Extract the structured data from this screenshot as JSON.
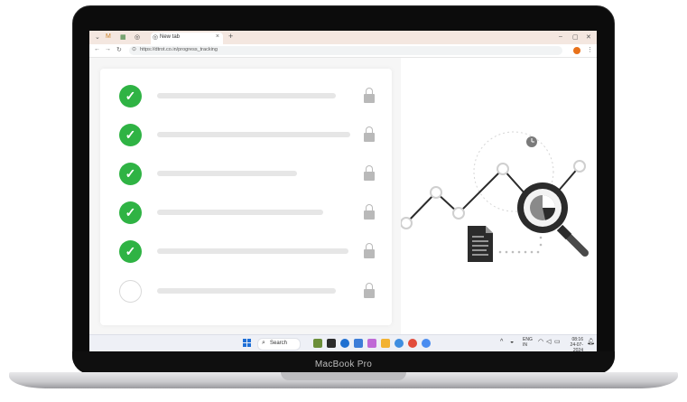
{
  "device": {
    "brand": "MacBook Pro"
  },
  "browser": {
    "tab": {
      "title": "New tab"
    },
    "address_bar": {
      "url": "https://dtrot.co.in/progress_tracking"
    }
  },
  "checklist": {
    "items": [
      {
        "status": "done",
        "bar_length_fraction": 0.76
      },
      {
        "status": "done",
        "bar_length_fraction": 0.84
      },
      {
        "status": "done",
        "bar_length_fraction": 0.6
      },
      {
        "status": "done",
        "bar_length_fraction": 0.71
      },
      {
        "status": "done",
        "bar_length_fraction": 0.81
      },
      {
        "status": "pending",
        "bar_length_fraction": 0.76
      }
    ],
    "accent_color": "#2fb344"
  },
  "illustration": {
    "icons": [
      "clock-icon",
      "document-icon",
      "magnifier-pie-icon"
    ]
  },
  "taskbar": {
    "search_label": "Search",
    "language": "ENG",
    "region": "IN",
    "time": "08:16",
    "date": "24-07-2024"
  }
}
